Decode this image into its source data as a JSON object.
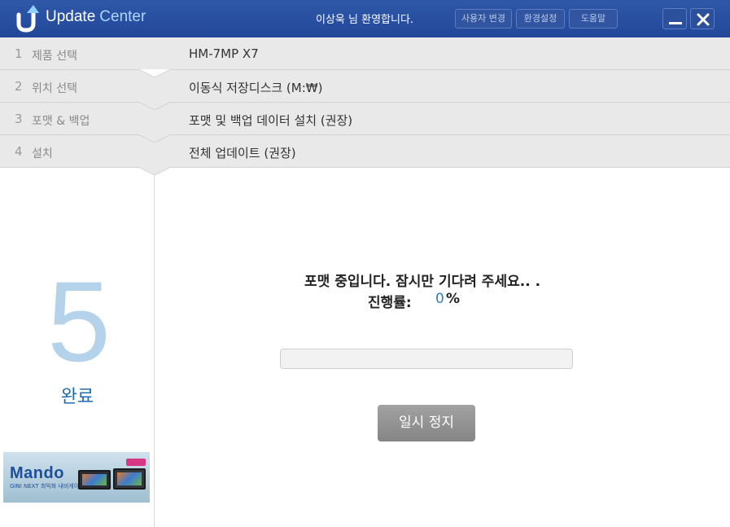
{
  "titlebar": {
    "title_part1": "Update",
    "title_part2": "Center",
    "welcome": "이상욱  님 환영합니다.",
    "buttons": {
      "change_user": "사용자 변경",
      "settings": "환경설정",
      "help": "도움말"
    },
    "icons": {
      "logo": "update-logo-icon",
      "minimize": "minimize-icon",
      "close": "close-icon"
    },
    "colors": {
      "bar": "#2a4f9f",
      "title_accent": "#a9d8ff"
    }
  },
  "steps": [
    {
      "num": "1",
      "label": "제품 선택",
      "value": "HM-7MP X7"
    },
    {
      "num": "2",
      "label": "위치 선택",
      "value": "이동식 저장디스크 (M:₩)"
    },
    {
      "num": "3",
      "label": "포맷 & 백업",
      "value": "포맷 및 백업 데이터 설치 (권장)"
    },
    {
      "num": "4",
      "label": "설치",
      "value": "전체 업데이트 (권장)"
    }
  ],
  "current_step": {
    "number": "5",
    "label": "완료"
  },
  "banner": {
    "brand": "Mando",
    "tagline": "GINI NEXT 최익화 내비게이션"
  },
  "status": {
    "message": "포맷 중입니다. 잠시만 기다려 주세요.. .",
    "progress_label": "진행률:",
    "progress_value": "0",
    "progress_unit": "%",
    "progress_fraction": 0
  },
  "pause_button": "일시 정지"
}
